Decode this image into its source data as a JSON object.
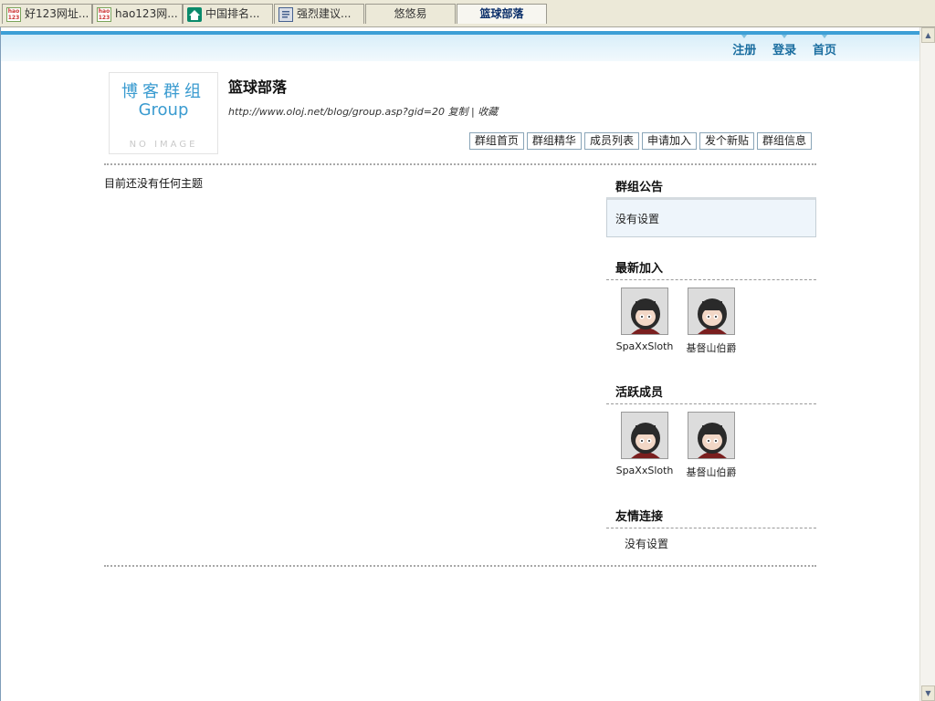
{
  "browser": {
    "tabs": [
      {
        "label": "好123网址...",
        "icon": "hao123-icon"
      },
      {
        "label": "hao123网...",
        "icon": "hao123-icon"
      },
      {
        "label": "中国排名...",
        "icon": "home-icon"
      },
      {
        "label": "强烈建议...",
        "icon": "document-icon"
      },
      {
        "label": "悠悠易",
        "icon": ""
      },
      {
        "label": "篮球部落",
        "icon": ""
      }
    ],
    "active_tab": 5
  },
  "topnav": {
    "register": "注册",
    "login": "登录",
    "home": "首页"
  },
  "group": {
    "logo_line1": "博客群组",
    "logo_line2": "Group",
    "logo_line3": "NO IMAGE",
    "title": "篮球部落",
    "url": "http://www.oloj.net/blog/group.asp?gid=20",
    "copy_label": "复制",
    "separator": "|",
    "favorite_label": "收藏"
  },
  "menu": [
    "群组首页",
    "群组精华",
    "成员列表",
    "申请加入",
    "发个新贴",
    "群组信息"
  ],
  "content": {
    "empty_text": "目前还没有任何主题"
  },
  "sidebar": {
    "notice_title": "群组公告",
    "notice_text": "没有设置",
    "newest_title": "最新加入",
    "newest_members": [
      "SpaXxSloth",
      "基督山伯爵"
    ],
    "active_title": "活跃成员",
    "active_members": [
      "SpaXxSloth",
      "基督山伯爵"
    ],
    "links_title": "友情连接",
    "links_text": "没有设置"
  },
  "colors": {
    "accent": "#3c9fd6",
    "nav_link": "#1b6ea0",
    "notice_bg": "#eef5fb"
  }
}
